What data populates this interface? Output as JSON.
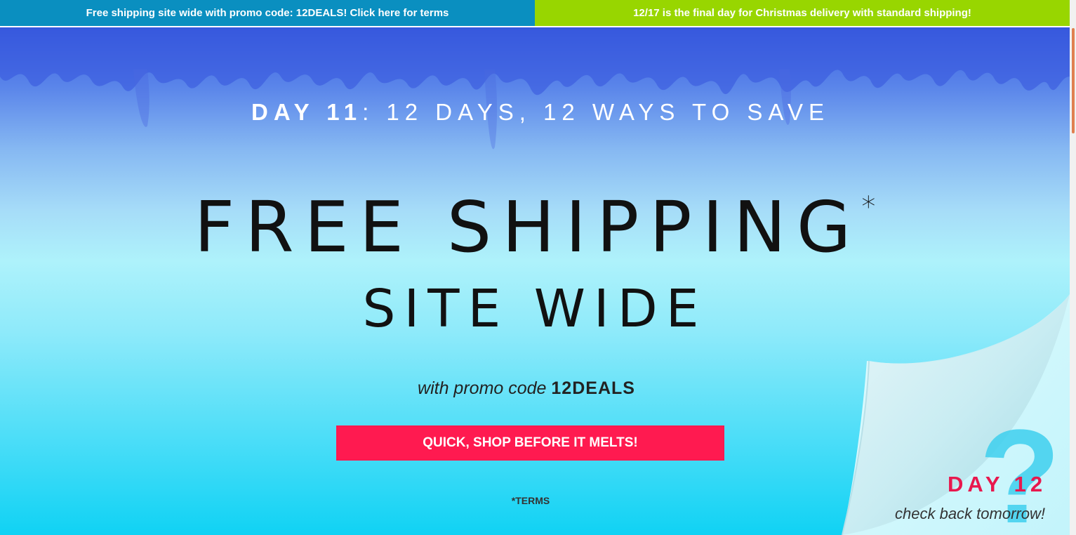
{
  "topbar": {
    "left_text": "Free shipping site wide with promo code: 12DEALS! Click here for terms",
    "right_text": "12/17 is the final day for Christmas delivery with standard shipping!",
    "left_color": "#0a8fc0",
    "right_color": "#98d600"
  },
  "hero": {
    "day_label": "DAY 11",
    "day_rest": ": 12 DAYS, 12 WAYS TO SAVE",
    "headline": "FREE SHIPPING",
    "headline_asterisk": "*",
    "subheadline": "SITE WIDE",
    "promo_prefix": "with promo code ",
    "promo_code": "12DEALS",
    "cta_label": "QUICK, SHOP BEFORE IT MELTS!",
    "cta_color": "#ff1a50",
    "terms_label": "*TERMS"
  },
  "teaser": {
    "day_label": "DAY 12",
    "subtitle": "check back tomorrow!",
    "icon": "question-mark-icon",
    "accent_color": "#e8184e"
  }
}
